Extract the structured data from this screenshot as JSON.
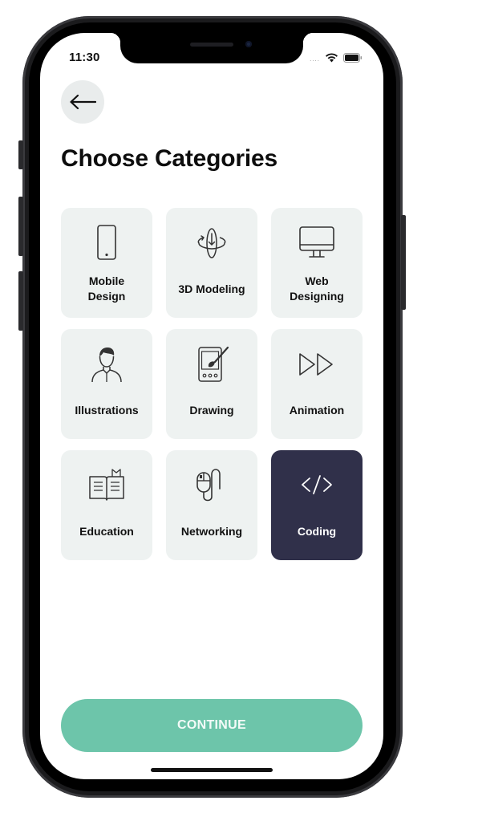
{
  "status_bar": {
    "time": "11:30",
    "dots": "....",
    "wifi_icon": "wifi-icon",
    "battery_icon": "battery-icon"
  },
  "header": {
    "back_icon": "arrow-left-icon",
    "title": "Choose Categories"
  },
  "categories": [
    {
      "label": "Mobile\nDesign",
      "icon": "smartphone-icon",
      "selected": false
    },
    {
      "label": "3D Modeling",
      "icon": "rotate-3d-icon",
      "selected": false
    },
    {
      "label": "Web\nDesigning",
      "icon": "monitor-icon",
      "selected": false
    },
    {
      "label": "Illustrations",
      "icon": "person-illustration-icon",
      "selected": false
    },
    {
      "label": "Drawing",
      "icon": "tablet-brush-icon",
      "selected": false
    },
    {
      "label": "Animation",
      "icon": "play-forward-icon",
      "selected": false
    },
    {
      "label": "Education",
      "icon": "open-book-icon",
      "selected": false
    },
    {
      "label": "Networking",
      "icon": "mouse-cable-icon",
      "selected": false
    },
    {
      "label": "Coding",
      "icon": "code-icon",
      "selected": true
    }
  ],
  "footer": {
    "continue_label": "CONTINUE"
  },
  "colors": {
    "card_bg": "#eef2f1",
    "selected_bg": "#30304a",
    "accent": "#6dc5aa"
  }
}
